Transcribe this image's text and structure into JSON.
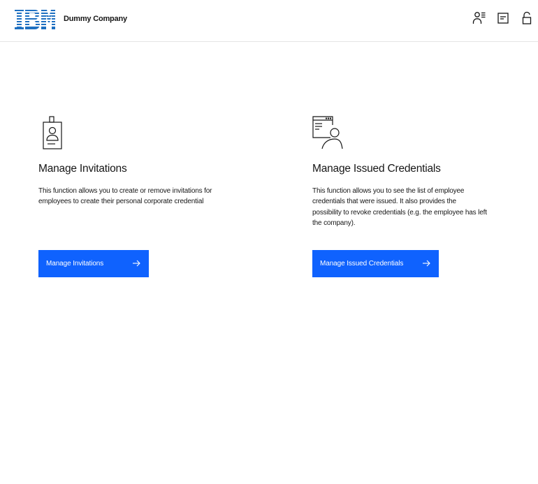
{
  "header": {
    "brand": "IBM",
    "company_name": "Dummy Company",
    "icons": [
      "user-list-icon",
      "document-icon",
      "unlock-icon"
    ]
  },
  "cards": [
    {
      "icon": "id-badge-icon",
      "title": "Manage Invitations",
      "description_lines": [
        "This function allows you to create or remove invitations for",
        "employees to create their personal corporate credential"
      ],
      "button_label": "Manage Invitations",
      "button_icon": "arrow-right-icon"
    },
    {
      "icon": "credential-user-icon",
      "title": "Manage Issued Credentials",
      "description_lines": [
        "This function allows you to see the list of employee",
        "credentials that were issued. It also provides the",
        "possibility to revoke credentials (e.g. the employee has left",
        "the company)."
      ],
      "button_label": "Manage Issued Credentials",
      "button_icon": "arrow-right-icon"
    }
  ],
  "colors": {
    "primary_button": "#0f62fe",
    "ibm_logo": "#1f70c1",
    "text": "#161616",
    "divider": "#e5e5e5"
  }
}
